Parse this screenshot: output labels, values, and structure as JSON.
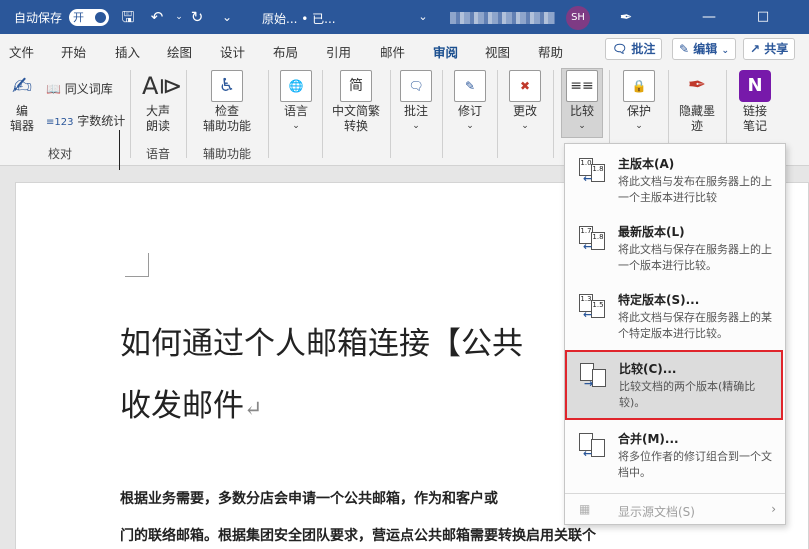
{
  "titlebar": {
    "autosave_label": "自动保存",
    "autosave_state": "开",
    "doc_title": "原始...  •  已...",
    "user_initials": "SH"
  },
  "tabs": [
    "文件",
    "开始",
    "插入",
    "绘图",
    "设计",
    "布局",
    "引用",
    "邮件",
    "审阅",
    "视图",
    "帮助"
  ],
  "active_tab": "审阅",
  "right_buttons": {
    "comments": "批注",
    "edit": "编辑",
    "share": "共享"
  },
  "ribbon": {
    "editor": "编\n辑器",
    "thesaurus": "同义词库",
    "wordcount": "字数统计",
    "readaloud": "大声\n朗读",
    "accessibility": "检查\n辅助功能",
    "language": "语言",
    "chinese_conv": "中文简繁\n转换",
    "comment": "批注",
    "tracking": "修订",
    "changes": "更改",
    "compare": "比较",
    "protect": "保护",
    "hide_ink": "隐藏墨\n迹",
    "linked_notes": "链接\n笔记",
    "groups": {
      "proofing": "校对",
      "speech": "语音",
      "accessibility": "辅助功能"
    }
  },
  "document": {
    "heading_line1": "如何通过个人邮箱连接【公共",
    "heading_line2": "收发邮件",
    "para_line1": "根据业务需要，多数分店会申请一个公共邮箱，作为和客户或",
    "para_line2": "门的联络邮箱。根据集团安全团队要求，营运点公共邮箱需要转换启用关联个"
  },
  "dropdown": {
    "items": [
      {
        "title": "主版本(A)",
        "desc": "将此文档与发布在服务器上的上一个主版本进行比较",
        "icon": "compare-major-version-icon"
      },
      {
        "title": "最新版本(L)",
        "desc": "将此文档与保存在服务器上的上一个版本进行比较。",
        "icon": "compare-last-version-icon"
      },
      {
        "title": "特定版本(S)...",
        "desc": "将此文档与保存在服务器上的某个特定版本进行比较。",
        "icon": "compare-specific-version-icon"
      },
      {
        "title": "比较(C)...",
        "desc": "比较文档的两个版本(精确比较)。",
        "icon": "compare-icon"
      },
      {
        "title": "合并(M)...",
        "desc": "将多位作者的修订组合到一个文档中。",
        "icon": "combine-icon"
      }
    ],
    "show_source": "显示源文档(S)",
    "highlight_color": "#e0252c"
  }
}
